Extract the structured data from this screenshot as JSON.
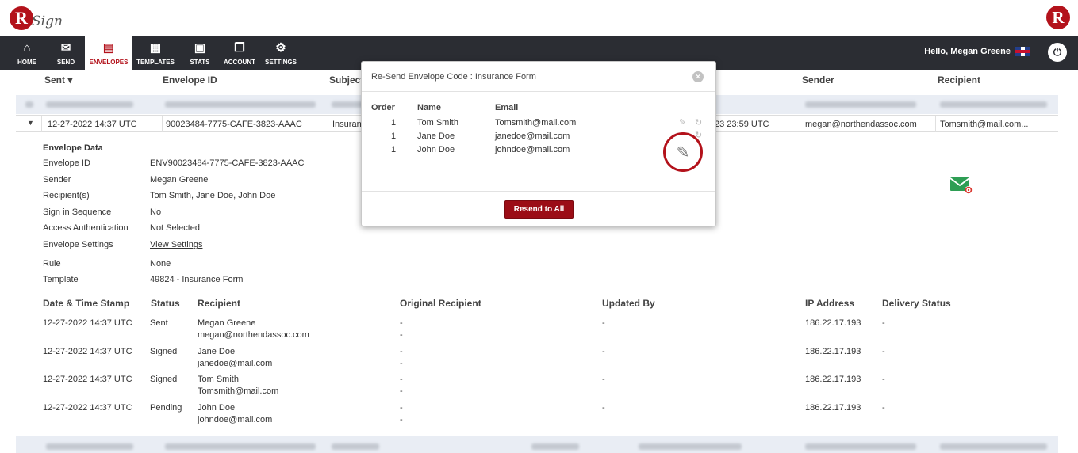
{
  "app": {
    "logo_letter": "R",
    "logo_text": "Sign",
    "brand_letter": "R"
  },
  "nav": {
    "items": [
      {
        "label": "HOME",
        "icon": "home-icon",
        "glyph": "⌂"
      },
      {
        "label": "SEND",
        "icon": "envelope-icon",
        "glyph": "✉"
      },
      {
        "label": "ENVELOPES",
        "icon": "envelopes-icon",
        "glyph": "▤"
      },
      {
        "label": "TEMPLATES",
        "icon": "templates-icon",
        "glyph": "▦"
      },
      {
        "label": "STATS",
        "icon": "briefcase-icon",
        "glyph": "▣"
      },
      {
        "label": "ACCOUNT",
        "icon": "account-icon",
        "glyph": "❐"
      },
      {
        "label": "SETTINGS",
        "icon": "gear-icon",
        "glyph": "⚙"
      }
    ],
    "active": "ENVELOPES",
    "greeting": "Hello, Megan Greene",
    "power_glyph": "⏻"
  },
  "table": {
    "headers": {
      "sent": "Sent ▾",
      "envelope_id": "Envelope ID",
      "subject": "Subject",
      "sender": "Sender",
      "recipient": "Recipient"
    },
    "row": {
      "sent": "12-27-2022 14:37 UTC",
      "envelope_id": "90023484-7775-CAFE-3823-AAAC",
      "subject": "Insuran",
      "expiry_partial": "23 23:59 UTC",
      "sender": "megan@northendassoc.com",
      "recipient": "Tomsmith@mail.com..."
    }
  },
  "envelope_data": {
    "title": "Envelope Data",
    "fields": [
      {
        "label": "Envelope ID",
        "value": "ENV90023484-7775-CAFE-3823-AAAC"
      },
      {
        "label": "Sender",
        "value": "Megan Greene"
      },
      {
        "label": "Recipient(s)",
        "value": "Tom Smith, Jane Doe, John Doe"
      },
      {
        "label": "Sign in Sequence",
        "value": "No"
      },
      {
        "label": "Access Authentication",
        "value": "Not Selected"
      },
      {
        "label": "Envelope Settings",
        "value": "View Settings"
      },
      {
        "label": "Rule",
        "value": "None"
      },
      {
        "label": "Template",
        "value": "49824 - Insurance Form"
      }
    ]
  },
  "history": {
    "headers": [
      "Date & Time Stamp",
      "Status",
      "Recipient",
      "Original Recipient",
      "Updated By",
      "IP Address",
      "Delivery Status"
    ],
    "rows": [
      {
        "date": "12-27-2022 14:37 UTC",
        "status": "Sent",
        "name": "Megan Greene",
        "email": "megan@northendassoc.com",
        "orig1": "-",
        "orig2": "-",
        "updated": "-",
        "ip": "186.22.17.193",
        "delivery": "-"
      },
      {
        "date": "12-27-2022 14:37 UTC",
        "status": "Signed",
        "name": "Jane Doe",
        "email": "janedoe@mail.com",
        "orig1": "-",
        "orig2": "-",
        "updated": "-",
        "ip": "186.22.17.193",
        "delivery": "-"
      },
      {
        "date": "12-27-2022 14:37 UTC",
        "status": "Signed",
        "name": "Tom Smith",
        "email": "Tomsmith@mail.com",
        "orig1": "-",
        "orig2": "-",
        "updated": "-",
        "ip": "186.22.17.193",
        "delivery": "-"
      },
      {
        "date": "12-27-2022 14:37 UTC",
        "status": "Pending",
        "name": "John Doe",
        "email": "johndoe@mail.com",
        "orig1": "-",
        "orig2": "-",
        "updated": "-",
        "ip": "186.22.17.193",
        "delivery": "-"
      }
    ]
  },
  "modal": {
    "title": "Re-Send Envelope Code : Insurance Form",
    "close_glyph": "×",
    "headers": {
      "order": "Order",
      "name": "Name",
      "email": "Email"
    },
    "rows": [
      {
        "order": "1",
        "name": "Tom Smith",
        "email": "Tomsmith@mail.com"
      },
      {
        "order": "1",
        "name": "Jane Doe",
        "email": "janedoe@mail.com"
      },
      {
        "order": "1",
        "name": "John Doe",
        "email": "johndoe@mail.com"
      }
    ],
    "edit_glyph": "✎",
    "refresh_glyph": "↻",
    "resend_label": "Resend to All"
  },
  "colors": {
    "brand_red": "#b3121b",
    "nav_bg": "#2b2d33",
    "button_red": "#9b0d16",
    "mail_green": "#2e9e54"
  }
}
